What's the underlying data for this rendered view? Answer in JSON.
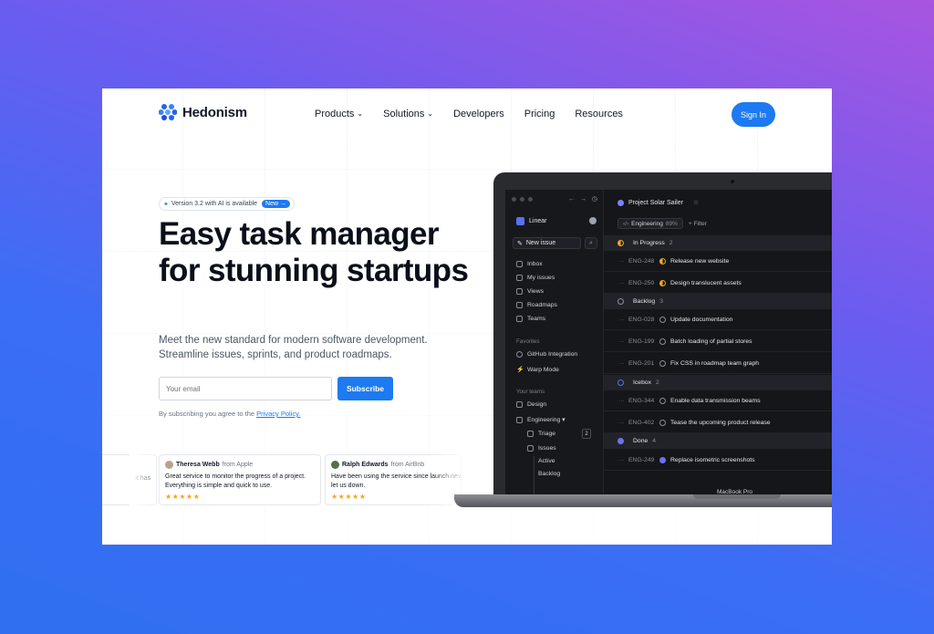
{
  "brand": {
    "name": "Hedonism"
  },
  "nav": {
    "items": [
      {
        "label": "Products",
        "has_dropdown": true
      },
      {
        "label": "Solutions",
        "has_dropdown": true
      },
      {
        "label": "Developers",
        "has_dropdown": false
      },
      {
        "label": "Pricing",
        "has_dropdown": false
      },
      {
        "label": "Resources",
        "has_dropdown": false
      }
    ],
    "signin": "Sign In"
  },
  "hero": {
    "badge_text": "Version 3.2 with AI is available",
    "badge_new": "New →",
    "headline": "Easy task manager for stunning startups",
    "subtext": "Meet the new standard for modern software development. Streamline issues, sprints, and product roadmaps.",
    "email_placeholder": "Your email",
    "subscribe": "Subscribe",
    "consent_prefix": "By subscribing you agree to the",
    "consent_link": "Privacy Policy."
  },
  "testimonials": [
    {
      "partial": "it has"
    },
    {
      "name": "Theresa Webb",
      "from": "from Apple",
      "quote": "Great service to monitor the progress of a project. Everything is simple and quick to use.",
      "stars": "★★★★★"
    },
    {
      "name": "Ralph Edwards",
      "from": "from AirBnb",
      "quote": "Have been using the service since launch never let us down.",
      "stars": "★★★★★"
    }
  ],
  "app": {
    "workspace": "Linear",
    "new_issue": "New issue",
    "sidebar": {
      "main": [
        "Inbox",
        "My issues",
        "Views",
        "Roadmaps",
        "Teams"
      ],
      "favorites_label": "Favorites",
      "favorites": [
        "GitHub Integration",
        "Warp Mode"
      ],
      "teams_label": "Your teams",
      "teams": [
        "Design",
        "Engineering ▾"
      ],
      "eng_items": [
        "Triage",
        "Issues",
        "Active",
        "Backlog"
      ],
      "triage_count": "2"
    },
    "project": "Project Solar Sailer",
    "filter_chip": "Engineering",
    "filter_pct": "89%",
    "filter_btn": "+ Filter",
    "groups": [
      {
        "label": "In Progress",
        "count": "2"
      },
      {
        "label": "Backlog",
        "count": "3"
      },
      {
        "label": "Icebox",
        "count": "2"
      },
      {
        "label": "Done",
        "count": "4"
      }
    ],
    "issues": [
      {
        "id": "ENG-248",
        "title": "Release new website",
        "status": "in-progress"
      },
      {
        "id": "ENG-250",
        "title": "Design translucent assets",
        "status": "in-progress"
      },
      {
        "id": "ENG-028",
        "title": "Update documentation",
        "status": "backlog"
      },
      {
        "id": "ENG-199",
        "title": "Batch loading of partial stores",
        "status": "backlog"
      },
      {
        "id": "ENG-201",
        "title": "Fix CSS in roadmap team graph",
        "status": "backlog"
      },
      {
        "id": "ENG-344",
        "title": "Enable data transmission beams",
        "status": "icebox"
      },
      {
        "id": "ENG-402",
        "title": "Tease the upcoming product release",
        "status": "icebox"
      },
      {
        "id": "ENG-249",
        "title": "Replace isometric screenshots",
        "status": "done"
      }
    ],
    "device_label": "MacBook Pro"
  },
  "colors": {
    "accent": "#1d7af0",
    "star": "#f5a524"
  }
}
